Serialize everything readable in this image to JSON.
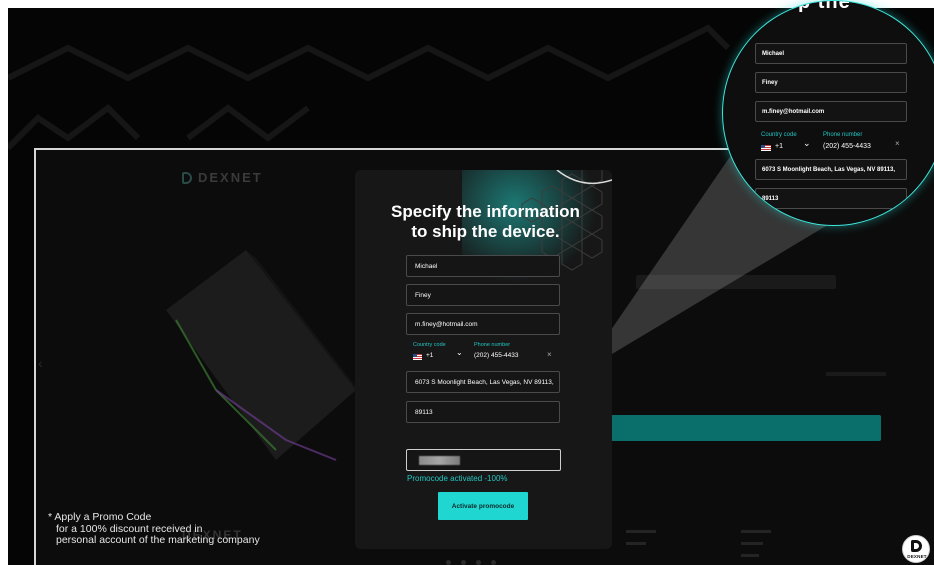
{
  "modal": {
    "title_line1": "Specify the information",
    "title_line2": "to ship the device.",
    "first_name": "Michael",
    "last_name": "Finey",
    "email": "m.finey@hotmail.com",
    "country_code_label": "Country code",
    "country_code_value": "+1",
    "phone_label": "Phone number",
    "phone_value": "(202) 455-4433",
    "clear_symbol": "×",
    "address": "6073 S Moonlight Beach, Las Vegas, NV 89113,",
    "zip": "89113",
    "promocode_status": "Promocode activated -100%",
    "activate_label": "Activate promocode"
  },
  "zoom": {
    "title_fragment": "p the",
    "first_name": "Michael",
    "last_name": "Finey",
    "email": "m.finey@hotmail.com",
    "country_code_label": "Country code",
    "country_code_value": "+1",
    "phone_label": "Phone number",
    "phone_value": "(202) 455-4433",
    "address": "6073 S Moonlight Beach, Las Vegas, NV 89113,",
    "zip": "89113"
  },
  "promo_note": {
    "line1": "* Apply a Promo Code",
    "line2": "for a 100% discount received in",
    "line3": "personal account of the marketing company"
  },
  "background_site": {
    "logo_text": "DEXNET",
    "footer_logo_text": "DEXNET"
  },
  "badge": {
    "text": "DEXNET"
  },
  "colors": {
    "accent": "#1fd6d0",
    "accent_text": "#22c7c2",
    "background": "#050505",
    "modal": "#171717",
    "zoom_border": "#3ee5dc"
  },
  "icons": {
    "flag": "us-flag-icon",
    "dropdown": "chevron-down-icon",
    "clear": "close-icon"
  }
}
